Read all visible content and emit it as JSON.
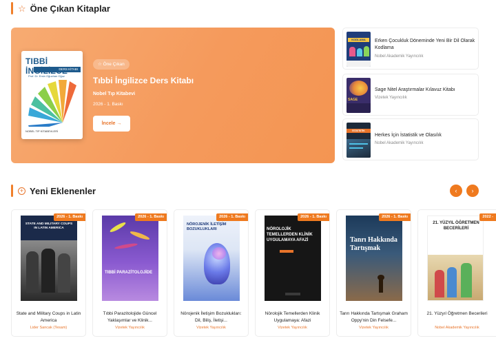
{
  "featured_section": {
    "title": "Öne Çıkan Kitaplar",
    "icon": "star-outline-icon"
  },
  "featured": {
    "badge": "☆ Öne Çıkan",
    "title": "Tıbbi İngilizce Ders Kitabı",
    "publisher": "Nobel Tıp Kitabevi",
    "edition": "2026 - 1. Baskı",
    "button_label": "İncele",
    "cover": {
      "title": "TIBBİ İNGİLİZCE",
      "subtitle": "DERS KİTABI",
      "author": "Prof. Dr. Ersin Oğuzhan Oğuz",
      "publisher": "NOBEL TIP KİTABEVLERİ"
    }
  },
  "side_books": [
    {
      "title": "Erken Çocukluk Döneminde Yeni Bir Dil Olarak Kodlama",
      "publisher": "Nobel Akademik Yayıncılık",
      "cover_text": "KODLAMA"
    },
    {
      "title": "Sage Nitel Araştırmalar Kılavuz Kitabı",
      "publisher": "Vizetek Yayıncılık",
      "cover_text": "SAGE"
    },
    {
      "title": "Herkes İçin İstatistik ve Olasılık",
      "publisher": "Nobel Akademik Yayıncılık",
      "cover_text": "İSTATİSTİK"
    }
  ],
  "new_section": {
    "title": "Yeni Eklenenler",
    "icon": "plus-circle-icon",
    "prev_icon": "‹",
    "next_icon": "›"
  },
  "new_books": [
    {
      "title": "State and Military Coups in Latin America",
      "publisher": "Lider Sancak (Tesam)",
      "edition": "2026 - 1. Baskı",
      "cover_text": "STATE AND MILITARY COUPS IN LATIN AMERICA"
    },
    {
      "title": "Tıbbi Parazitolojide Güncel Yaklaşımlar ve Klinik...",
      "publisher": "Vizetek Yayıncılık",
      "edition": "2026 - 1. Baskı",
      "cover_text": "TIBBİ PARAZİTOLOJİDE"
    },
    {
      "title": "Nörojenik İletişim Bozuklukları: Dil, Biliş, İletişi...",
      "publisher": "Vizetek Yayıncılık",
      "edition": "2026 - 1. Baskı",
      "cover_text": "NÖROJENİK İLETİŞİM BOZUKLUKLARI"
    },
    {
      "title": "Nörolojik Temellerden Klinik Uygulamaya: Afazi",
      "publisher": "Vizetek Yayıncılık",
      "edition": "2026 - 1. Baskı",
      "cover_text": "NÖROLOJİK TEMELLERDEN KLİNİK UYGULAMAYA AFAZİ"
    },
    {
      "title": "Tanrı Hakkında Tartışmak Graham Oppy'nin Din Felsefe...",
      "publisher": "Vizetek Yayıncılık",
      "edition": "2026 - 1. Baskı",
      "cover_text": "Tanrı Hakkında Tartışmak"
    },
    {
      "title": "21. Yüzyıl Öğretmen Becerileri",
      "publisher": "Nobel Akademik Yayıncılık",
      "edition": "2022 -",
      "cover_text": "21. YÜZYIL ÖĞRETMEN BECERİLERİ"
    }
  ]
}
